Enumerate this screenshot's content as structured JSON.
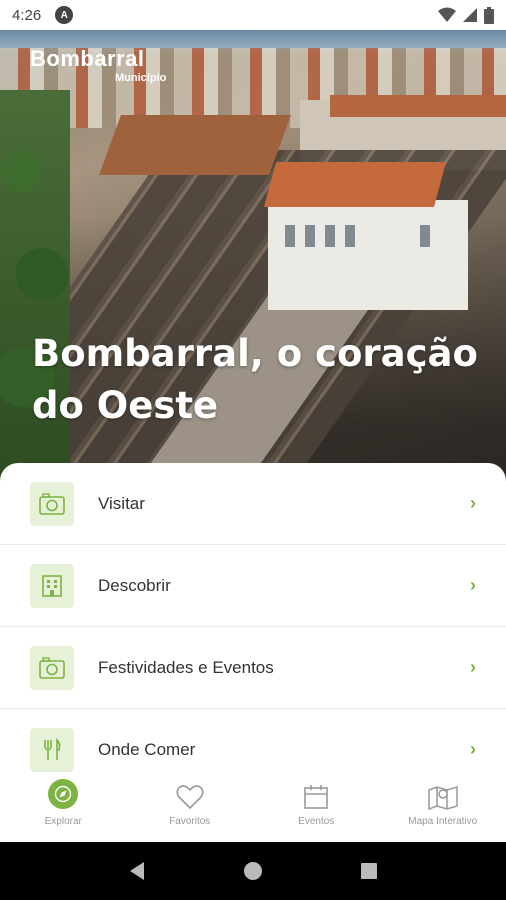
{
  "status_bar": {
    "time": "4:26",
    "notification_icon": "a-circle-icon"
  },
  "hero": {
    "logo_name": "Bombarral",
    "logo_sub": "Município",
    "title": "Bombarral, o coração do Oeste"
  },
  "menu": {
    "items": [
      {
        "label": "Visitar",
        "icon": "camera-icon"
      },
      {
        "label": "Descobrir",
        "icon": "building-icon"
      },
      {
        "label": "Festividades e Eventos",
        "icon": "camera-icon"
      },
      {
        "label": "Onde Comer",
        "icon": "fork-knife-icon"
      }
    ]
  },
  "bottom_nav": {
    "items": [
      {
        "label": "Explorar",
        "icon": "compass-icon",
        "active": true
      },
      {
        "label": "Favoritos",
        "icon": "heart-icon"
      },
      {
        "label": "Eventos",
        "icon": "calendar-icon"
      },
      {
        "label": "Mapa Interativo",
        "icon": "map-icon"
      }
    ]
  },
  "colors": {
    "accent": "#7cb342",
    "icon_bg": "#e6f1d8"
  }
}
